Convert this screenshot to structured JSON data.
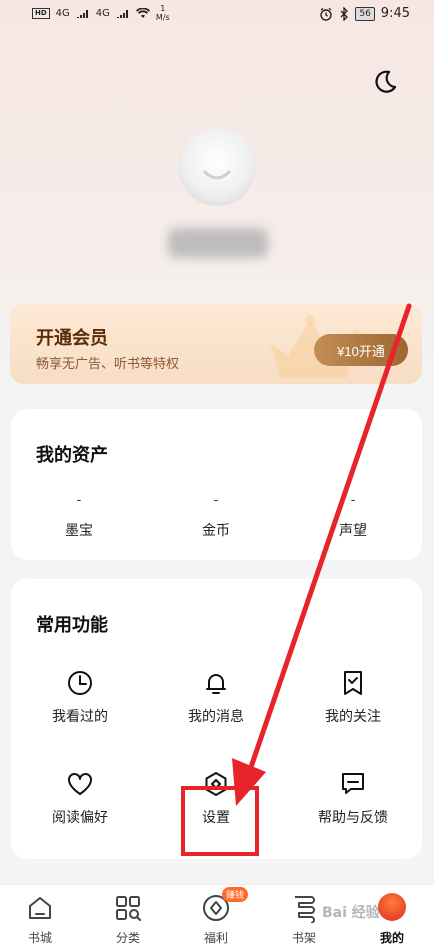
{
  "status_bar": {
    "hd": "HD",
    "signal_1": "4G",
    "signal_2": "4G",
    "speed_value": "1",
    "speed_unit": "M/s",
    "battery": "56",
    "time": "9:45"
  },
  "vip": {
    "title": "开通会员",
    "subtitle": "畅享无广告、听书等特权",
    "button": "¥10开通"
  },
  "assets": {
    "title": "我的资产",
    "items": [
      {
        "value": "-",
        "label": "墨宝"
      },
      {
        "value": "-",
        "label": "金币"
      },
      {
        "value": "-",
        "label": "声望"
      }
    ]
  },
  "functions": {
    "title": "常用功能",
    "items": [
      {
        "label": "我看过的",
        "icon": "clock-icon"
      },
      {
        "label": "我的消息",
        "icon": "bell-icon"
      },
      {
        "label": "我的关注",
        "icon": "bookmark-check-icon"
      },
      {
        "label": "阅读偏好",
        "icon": "heart-icon"
      },
      {
        "label": "设置",
        "icon": "settings-icon"
      },
      {
        "label": "帮助与反馈",
        "icon": "feedback-icon"
      }
    ]
  },
  "tabbar": {
    "items": [
      {
        "label": "书城",
        "icon": "home-icon"
      },
      {
        "label": "分类",
        "icon": "category-icon"
      },
      {
        "label": "福利",
        "icon": "welfare-icon",
        "badge": "赚钱"
      },
      {
        "label": "书架",
        "icon": "bookshelf-icon"
      },
      {
        "label": "我的",
        "icon": "avatar-icon"
      }
    ]
  },
  "watermark": "Bai 经验",
  "colors": {
    "accent_orange": "#ff6a2a",
    "vip_gold": "#b07a40",
    "annotation_red": "#e8242a"
  }
}
